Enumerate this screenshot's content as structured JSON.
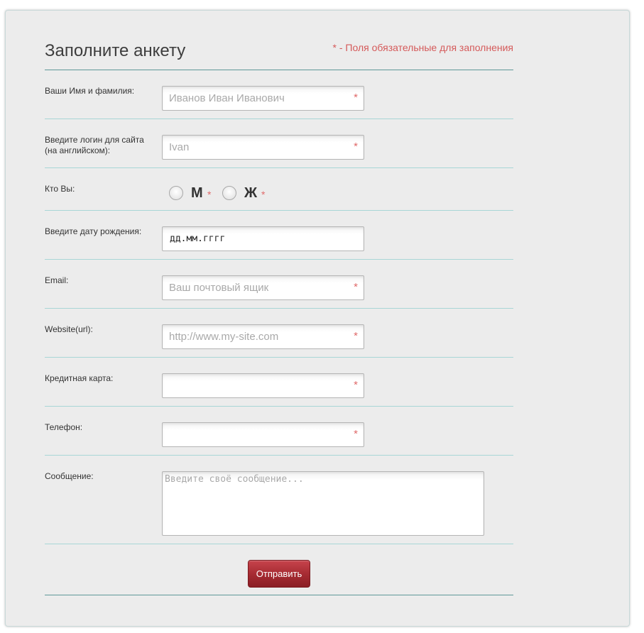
{
  "form": {
    "title": "Заполните анкету",
    "required_note": "* - Поля обязательные для заполнения",
    "required_star": "*",
    "accent_color": "#d55a5a",
    "fields": {
      "full_name": {
        "label": "Ваши Имя и фамилия:",
        "placeholder": "Иванов Иван Иванович",
        "value": ""
      },
      "login": {
        "label": "Введите логин для сайта (на английском):",
        "placeholder": "Ivan",
        "value": ""
      },
      "gender": {
        "label": "Кто Вы:",
        "options": [
          "М",
          "Ж"
        ],
        "selected": null
      },
      "birth_date": {
        "label": "Введите дату рождения:",
        "value": "дд.мм.гггг"
      },
      "email": {
        "label": "Email:",
        "placeholder": "Ваш почтовый ящик",
        "value": ""
      },
      "website": {
        "label": "Website(url):",
        "placeholder": "http://www.my-site.com",
        "value": ""
      },
      "credit_card": {
        "label": "Кредитная карта:",
        "placeholder": "",
        "value": ""
      },
      "phone": {
        "label": "Телефон:",
        "placeholder": "",
        "value": ""
      },
      "message": {
        "label": "Сообщение:",
        "placeholder": "Введите своё сообщение...",
        "value": ""
      }
    },
    "submit_label": "Отправить",
    "submit_color": "#a42a31"
  }
}
